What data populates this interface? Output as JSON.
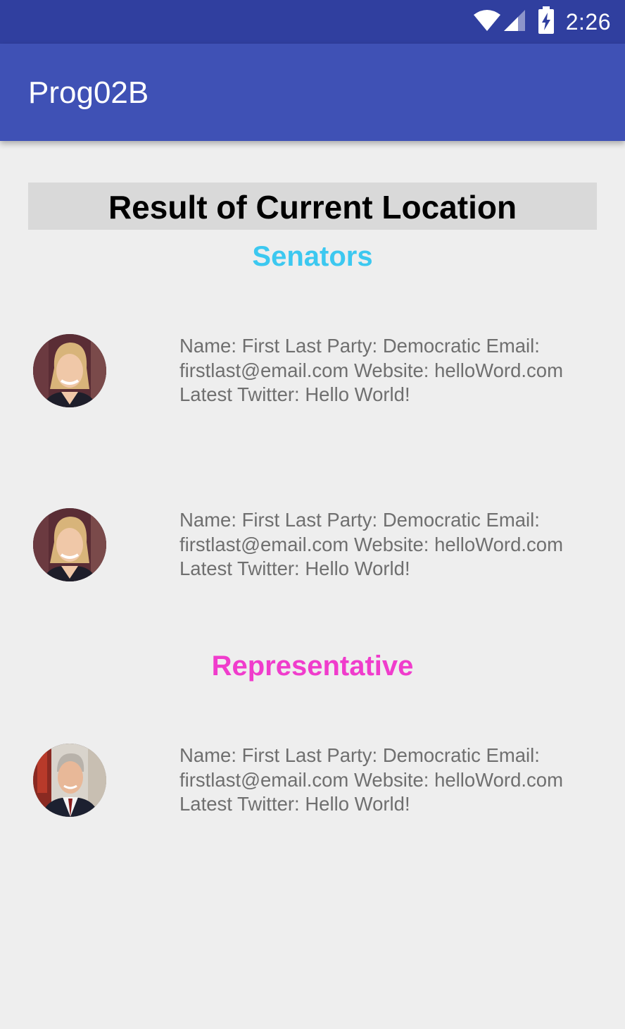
{
  "status_bar": {
    "time": "2:26",
    "icons": [
      "wifi-icon",
      "signal-icon",
      "battery-charging-icon"
    ]
  },
  "app_bar": {
    "title": "Prog02B"
  },
  "header": {
    "title": "Result of Current Location"
  },
  "senators": {
    "title": "Senators",
    "color": "#3cc8f0",
    "items": [
      {
        "info": "Name: First Last Party: Democratic Email: firstlast@email.com Website: helloWord.com Latest Twitter: Hello World!"
      },
      {
        "info": "Name: First Last Party: Democratic Email: firstlast@email.com Website: helloWord.com Latest Twitter: Hello World!"
      }
    ]
  },
  "representatives": {
    "title": "Representative",
    "color": "#f03ccc",
    "items": [
      {
        "info": "Name: First Last Party: Democratic Email: firstlast@email.com Website: helloWord.com Latest Twitter: Hello World!"
      }
    ]
  },
  "colors": {
    "status_bar": "#303f9f",
    "app_bar": "#3f51b5",
    "background": "#eeeeee"
  }
}
